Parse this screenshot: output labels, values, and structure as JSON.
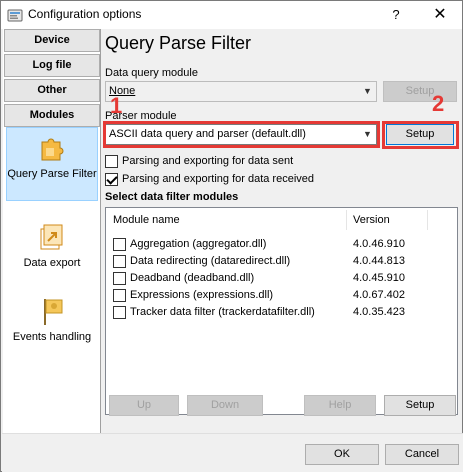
{
  "window": {
    "title": "Configuration options",
    "help_glyph": "?",
    "close_glyph": "✕"
  },
  "sidebar": {
    "categories": [
      {
        "label": "Device"
      },
      {
        "label": "Log file"
      },
      {
        "label": "Other"
      },
      {
        "label": "Modules"
      }
    ],
    "items": [
      {
        "label": "Query Parse Filter",
        "icon": "puzzle-icon",
        "active": true
      },
      {
        "label": "Data export",
        "icon": "export-icon",
        "active": false
      },
      {
        "label": "Events handling",
        "icon": "flag-icon",
        "active": false
      }
    ]
  },
  "main": {
    "title": "Query Parse Filter",
    "data_query_module": {
      "label": "Data query module",
      "value": "None",
      "setup": "Setup"
    },
    "parser_module": {
      "label": "Parser module",
      "value": "ASCII data query and parser (default.dll)",
      "setup": "Setup"
    },
    "options": [
      {
        "label": "Parsing and exporting for data sent",
        "checked": false
      },
      {
        "label": "Parsing and exporting for data received",
        "checked": true
      }
    ],
    "filters": {
      "heading": "Select data filter modules",
      "columns": {
        "name": "Module name",
        "version": "Version"
      },
      "rows": [
        {
          "name": "Aggregation (aggregator.dll)",
          "version": "4.0.46.910",
          "checked": false
        },
        {
          "name": "Data redirecting (dataredirect.dll)",
          "version": "4.0.44.813",
          "checked": false
        },
        {
          "name": "Deadband (deadband.dll)",
          "version": "4.0.45.910",
          "checked": false
        },
        {
          "name": "Expressions (expressions.dll)",
          "version": "4.0.67.402",
          "checked": false
        },
        {
          "name": "Tracker data filter (trackerdatafilter.dll)",
          "version": "4.0.35.423",
          "checked": false
        }
      ]
    },
    "bottom_buttons": {
      "up": "Up",
      "down": "Down",
      "help": "Help",
      "setup": "Setup"
    }
  },
  "annotations": {
    "marker1": "1",
    "marker2": "2",
    "color": "#e53935"
  },
  "footer": {
    "ok": "OK",
    "cancel": "Cancel"
  }
}
